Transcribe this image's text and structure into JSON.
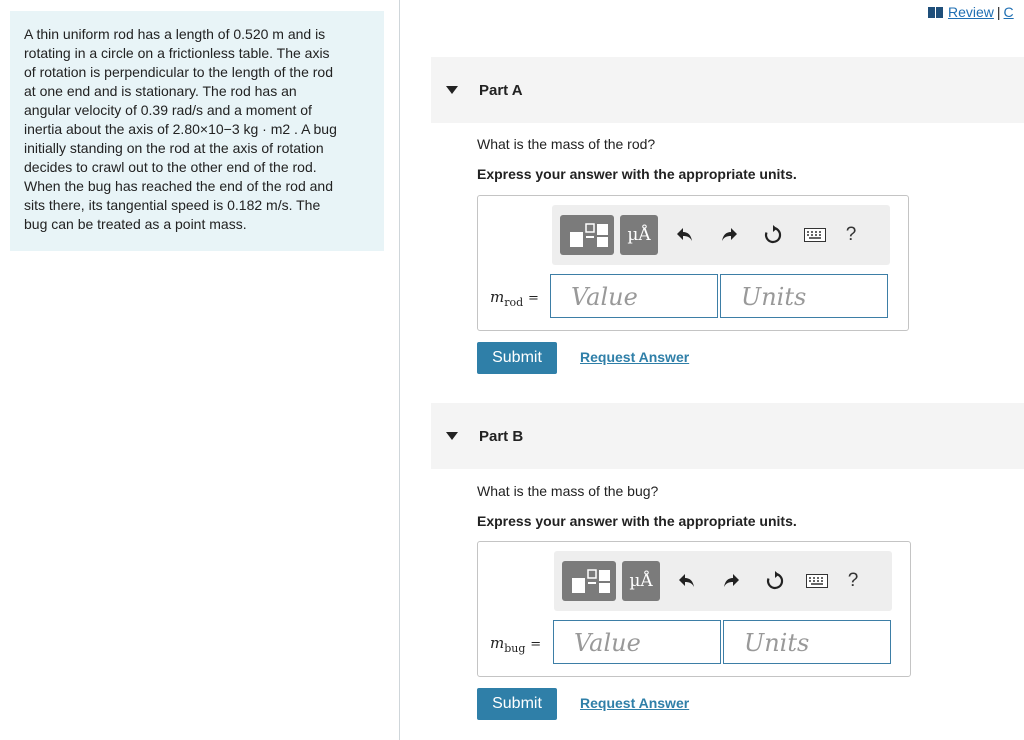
{
  "problem": {
    "lines": [
      "A thin uniform rod has a length of 0.520 m and is",
      "rotating in a circle on a frictionless table. The axis",
      "of rotation is perpendicular to the length of the rod",
      "at one end and is stationary. The rod has an",
      "angular velocity of 0.39 rad/s and a moment of",
      "inertia about the axis of 2.80×10−3 kg · m2 . A bug",
      "initially standing on the rod at the axis of rotation",
      "decides to crawl out to the other end of the rod.",
      "When the bug has reached the end of the rod and",
      "sits there, its tangential speed is 0.182 m/s. The",
      "bug can be treated as a point mass."
    ]
  },
  "header": {
    "review_label": "Review",
    "separator": "|",
    "next_label": "C"
  },
  "parts": [
    {
      "title": "Part A",
      "question": "What is the mass of the rod?",
      "instruction": "Express your answer with the appropriate units.",
      "var_main": "m",
      "var_sub": "rod",
      "equals": "=",
      "value_placeholder": "Value",
      "units_placeholder": "Units",
      "unit_button": "µÅ",
      "help": "?",
      "submit": "Submit",
      "request": "Request Answer"
    },
    {
      "title": "Part B",
      "question": "What is the mass of the bug?",
      "instruction": "Express your answer with the appropriate units.",
      "var_main": "m",
      "var_sub": "bug",
      "equals": "=",
      "value_placeholder": "Value",
      "units_placeholder": "Units",
      "unit_button": "µÅ",
      "help": "?",
      "submit": "Submit",
      "request": "Request Answer"
    }
  ],
  "colors": {
    "problem_bg": "#e8f4f7",
    "accent": "#2f7fa8",
    "field_border": "#3d7ea6"
  }
}
